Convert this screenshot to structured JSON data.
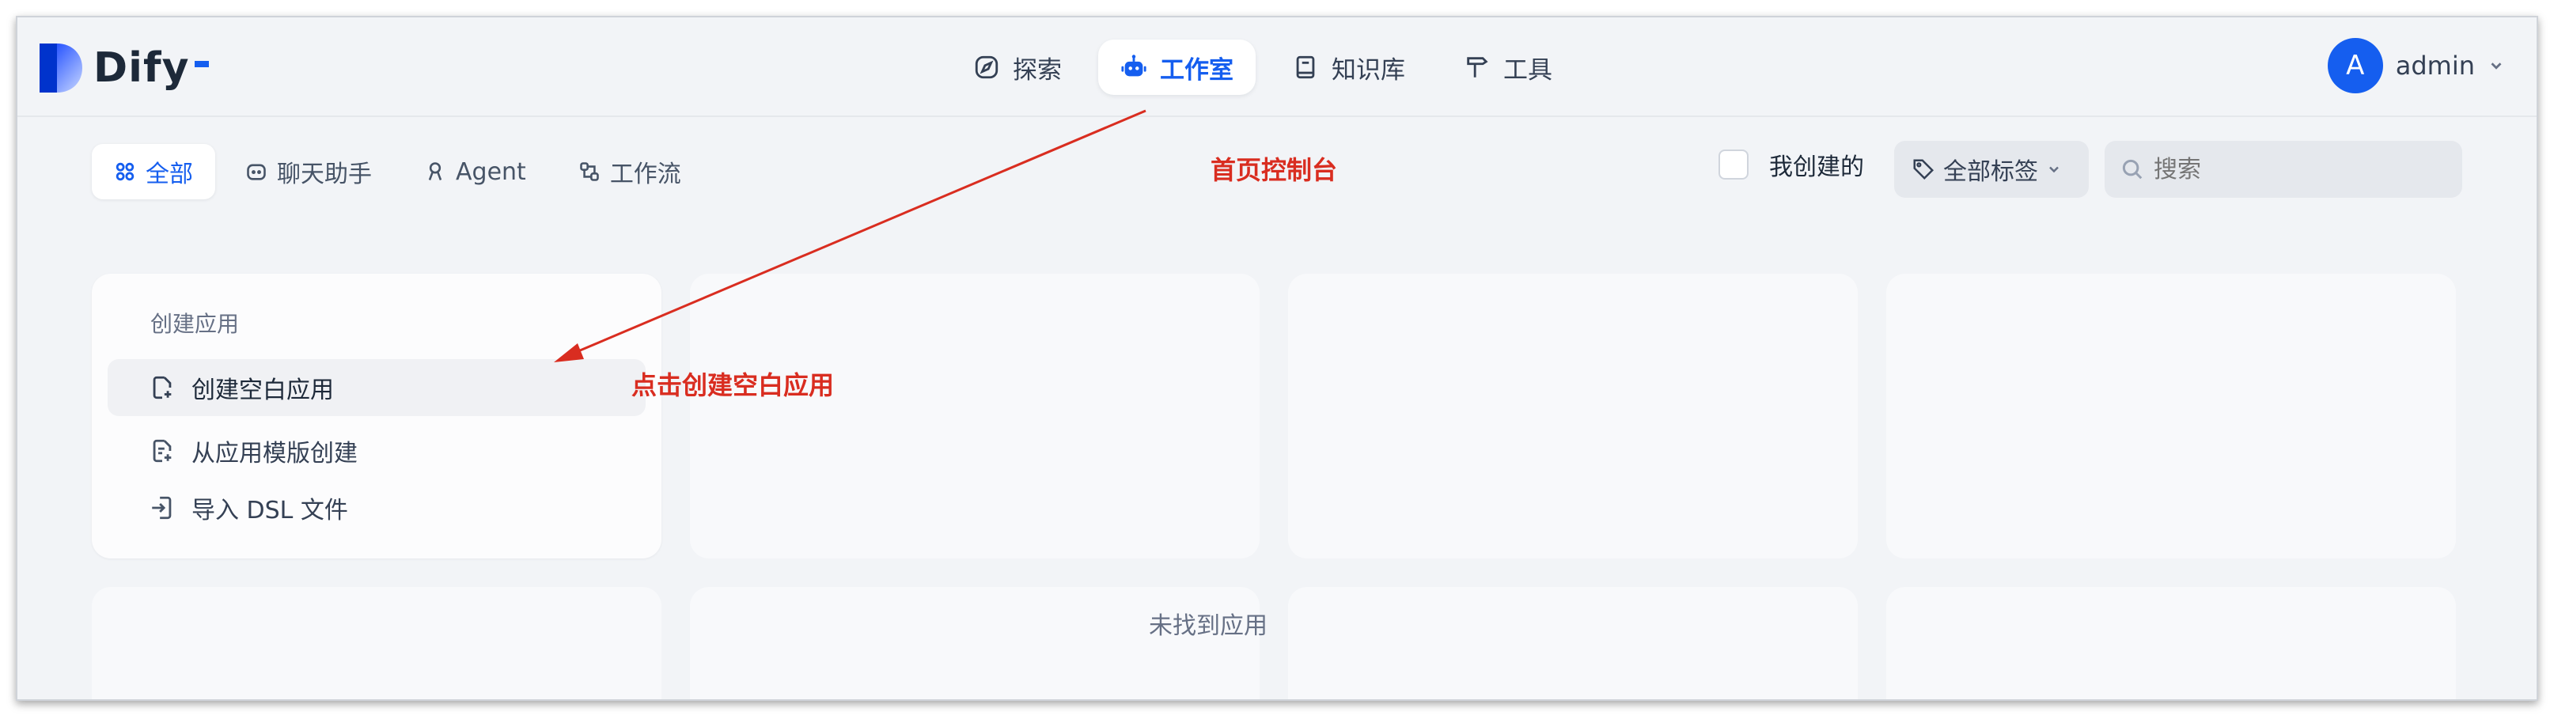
{
  "app": {
    "name": "Dify"
  },
  "nav": {
    "items": [
      {
        "label": "探索",
        "icon": "compass-icon",
        "active": false
      },
      {
        "label": "工作室",
        "icon": "robot-icon",
        "active": true
      },
      {
        "label": "知识库",
        "icon": "book-icon",
        "active": false
      },
      {
        "label": "工具",
        "icon": "hammer-icon",
        "active": false
      }
    ]
  },
  "user": {
    "avatar_letter": "A",
    "name": "admin"
  },
  "tabs": [
    {
      "label": "全部",
      "active": true
    },
    {
      "label": "聊天助手",
      "active": false
    },
    {
      "label": "Agent",
      "active": false
    },
    {
      "label": "工作流",
      "active": false
    }
  ],
  "filters": {
    "mine_label": "我创建的",
    "mine_checked": false,
    "tags_label": "全部标签",
    "search_placeholder": "搜索"
  },
  "create_card": {
    "title": "创建应用",
    "items": [
      {
        "label": "创建空白应用"
      },
      {
        "label": "从应用模版创建"
      },
      {
        "label": "导入 DSL 文件"
      }
    ]
  },
  "empty_state": "未找到应用",
  "annotations": {
    "console": "首页控制台",
    "click_create": "点击创建空白应用"
  },
  "colors": {
    "accent": "#155eef",
    "annotation": "#d92d20",
    "background": "#f2f4f7"
  }
}
